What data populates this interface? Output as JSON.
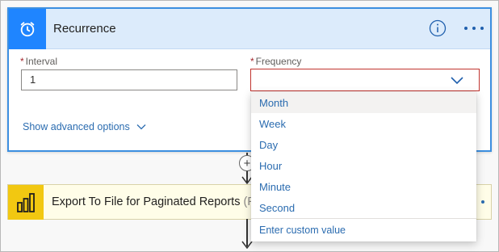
{
  "recurrence_card": {
    "title": "Recurrence",
    "icon": "alarm-clock-icon",
    "accent_color": "#1f85ff",
    "interval": {
      "required_mark": "*",
      "label": "Interval",
      "value": "1"
    },
    "frequency": {
      "required_mark": "*",
      "label": "Frequency",
      "value": ""
    },
    "advanced_options_label": "Show advanced options"
  },
  "frequency_dropdown": {
    "options": [
      "Month",
      "Week",
      "Day",
      "Hour",
      "Minute",
      "Second"
    ],
    "hovered": "Month",
    "custom_value_label": "Enter custom value"
  },
  "export_card": {
    "title": "Export To File for Paginated Reports",
    "title_suffix": "(Pre",
    "icon": "power-bi-icon",
    "accent_color": "#f2c811"
  },
  "connector": {
    "add_symbol": "+"
  }
}
